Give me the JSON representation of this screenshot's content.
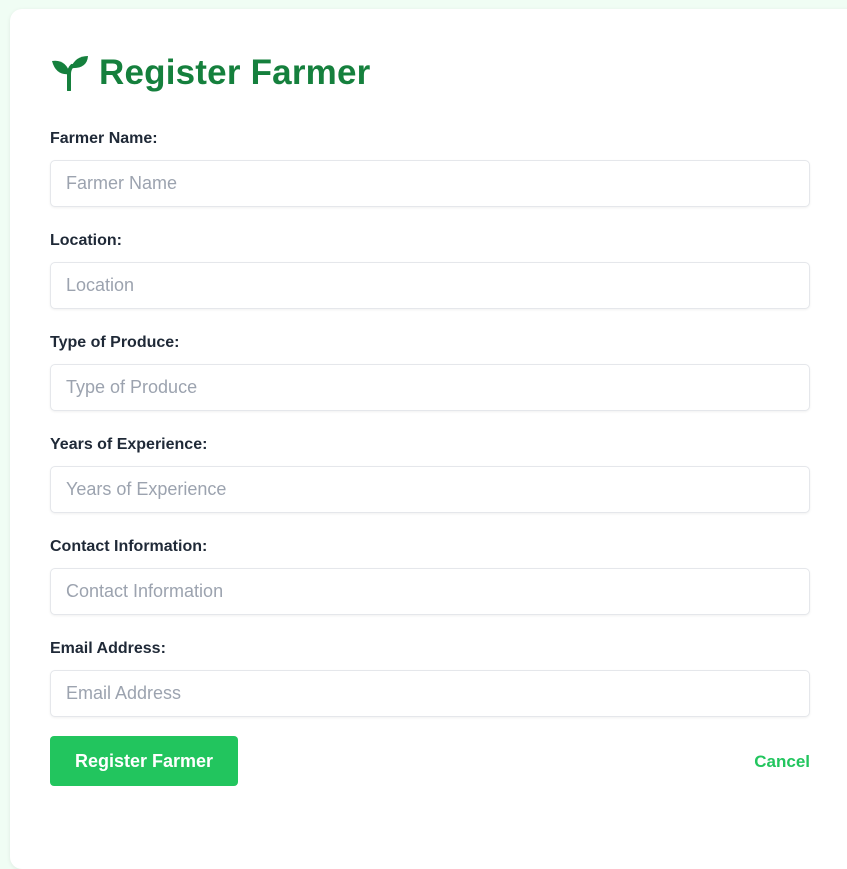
{
  "form": {
    "title": "Register Farmer",
    "icon": "sprout-icon",
    "colors": {
      "title": "#15803d",
      "accent": "#22c55e",
      "background": "#f0fdf4"
    },
    "fields": [
      {
        "label": "Farmer Name:",
        "placeholder": "Farmer Name",
        "value": ""
      },
      {
        "label": "Location:",
        "placeholder": "Location",
        "value": ""
      },
      {
        "label": "Type of Produce:",
        "placeholder": "Type of Produce",
        "value": ""
      },
      {
        "label": "Years of Experience:",
        "placeholder": "Years of Experience",
        "value": ""
      },
      {
        "label": "Contact Information:",
        "placeholder": "Contact Information",
        "value": ""
      },
      {
        "label": "Email Address:",
        "placeholder": "Email Address",
        "value": ""
      }
    ],
    "submit_label": "Register Farmer",
    "cancel_label": "Cancel"
  }
}
